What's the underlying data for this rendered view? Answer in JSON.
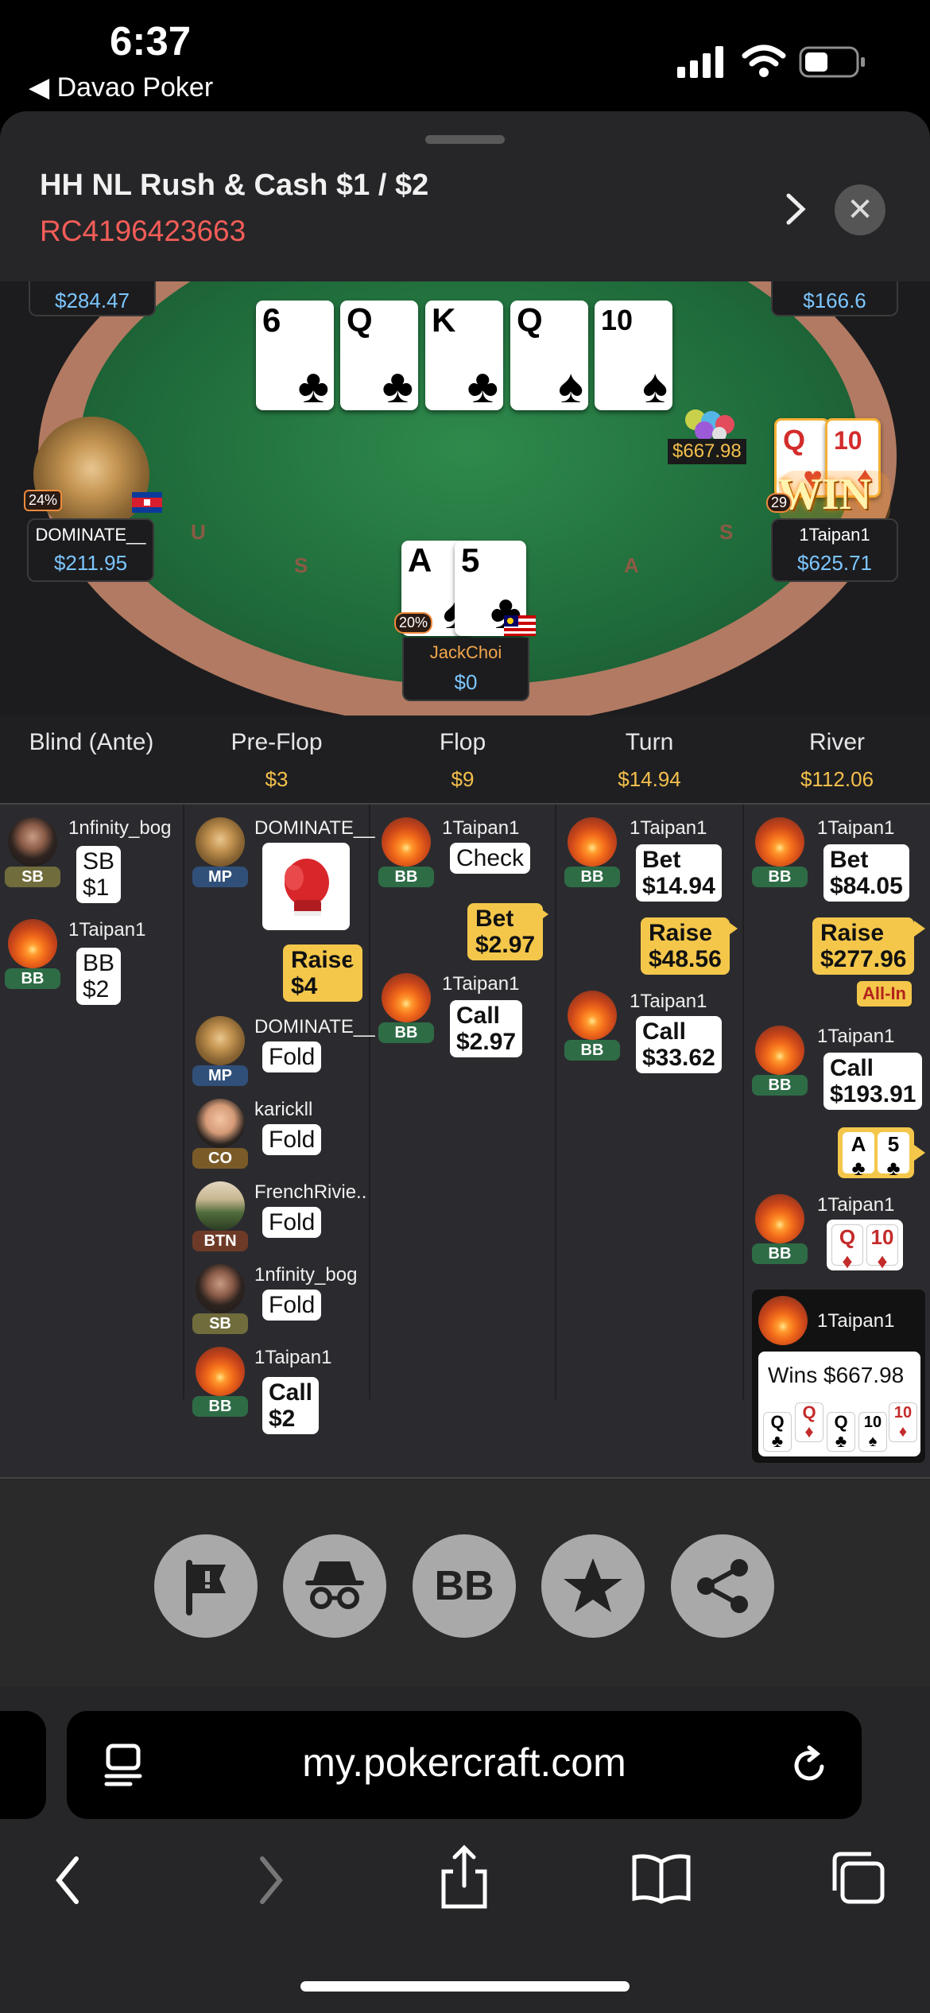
{
  "status_bar": {
    "time": "6:37",
    "back_label": "◀ Davao Poker"
  },
  "header": {
    "title": "HH NL Rush & Cash $1 / $2",
    "hand_id": "RC4196423663"
  },
  "table": {
    "board": [
      {
        "rank": "6",
        "suit": "♣"
      },
      {
        "rank": "Q",
        "suit": "♣"
      },
      {
        "rank": "K",
        "suit": "♣"
      },
      {
        "rank": "Q",
        "suit": "♠"
      },
      {
        "rank": "10",
        "suit": "♠"
      }
    ],
    "rim_letters": [
      "U",
      "S",
      "A",
      "S"
    ],
    "pot": "$667.98",
    "top_left_stack": "$284.47",
    "top_right_stack": "$166.6",
    "left_player": {
      "name": "DOMINATE__",
      "stack": "$211.95",
      "badge": "24%"
    },
    "right_player": {
      "name": "1Taipan1",
      "stack": "$625.71",
      "badge": "29",
      "win_label": "WIN",
      "cards": [
        {
          "rank": "Q",
          "suit": "♥"
        },
        {
          "rank": "10",
          "suit": "♦"
        }
      ]
    },
    "hero": {
      "name": "JackChoi",
      "stack": "$0",
      "badge": "20%",
      "cards": [
        {
          "rank": "A",
          "suit": "♠"
        },
        {
          "rank": "5",
          "suit": "♣"
        }
      ]
    }
  },
  "history": {
    "columns": [
      {
        "title": "Blind (Ante)",
        "pot": ""
      },
      {
        "title": "Pre-Flop",
        "pot": "$3"
      },
      {
        "title": "Flop",
        "pot": "$9"
      },
      {
        "title": "Turn",
        "pot": "$14.94"
      },
      {
        "title": "River",
        "pot": "$112.06"
      }
    ],
    "blind": [
      {
        "name": "1nfinity_bog",
        "pos": "SB",
        "action": "SB",
        "amount": "$1"
      },
      {
        "name": "1Taipan1",
        "pos": "BB",
        "action": "BB",
        "amount": "$2"
      }
    ],
    "preflop": {
      "straddle_name": "DOMINATE__",
      "straddle_pos": "MP",
      "raise_action": "Raise",
      "raise_amount": "$4",
      "rows": [
        {
          "name": "DOMINATE__",
          "pos": "MP",
          "action": "Fold"
        },
        {
          "name": "karickll",
          "pos": "CO",
          "action": "Fold"
        },
        {
          "name": "FrenchRivie..",
          "pos": "BTN",
          "action": "Fold"
        },
        {
          "name": "1nfinity_bog",
          "pos": "SB",
          "action": "Fold"
        }
      ],
      "call": {
        "name": "1Taipan1",
        "pos": "BB",
        "action": "Call",
        "amount": "$2"
      }
    },
    "flop": {
      "p1": {
        "name": "1Taipan1",
        "pos": "BB",
        "action": "Check"
      },
      "hero_bet": {
        "action": "Bet",
        "amount": "$2.97"
      },
      "p2": {
        "name": "1Taipan1",
        "pos": "BB",
        "action": "Call",
        "amount": "$2.97"
      }
    },
    "turn": {
      "p1": {
        "name": "1Taipan1",
        "pos": "BB",
        "action": "Bet",
        "amount": "$14.94"
      },
      "hero_raise": {
        "action": "Raise",
        "amount": "$48.56"
      },
      "p2": {
        "name": "1Taipan1",
        "pos": "BB",
        "action": "Call",
        "amount": "$33.62"
      }
    },
    "river": {
      "p1": {
        "name": "1Taipan1",
        "pos": "BB",
        "action": "Bet",
        "amount": "$84.05"
      },
      "hero_raise": {
        "action": "Raise",
        "amount": "$277.96",
        "tag": "All-In"
      },
      "p2": {
        "name": "1Taipan1",
        "pos": "BB",
        "action": "Call",
        "amount": "$193.91"
      },
      "hero_show": [
        {
          "rank": "A",
          "suit": "♣"
        },
        {
          "rank": "5",
          "suit": "♣"
        }
      ],
      "p3": {
        "name": "1Taipan1",
        "pos": "BB",
        "cards": [
          {
            "rank": "Q",
            "suit": "♦"
          },
          {
            "rank": "10",
            "suit": "♦"
          }
        ]
      },
      "winner": {
        "name": "1Taipan1",
        "text": "Wins $667.98",
        "cards": [
          {
            "rank": "Q",
            "suit": "♣"
          },
          {
            "rank": "Q",
            "suit": "♦"
          },
          {
            "rank": "Q",
            "suit": "♣"
          },
          {
            "rank": "10",
            "suit": "♠"
          },
          {
            "rank": "10",
            "suit": "♦"
          }
        ]
      }
    }
  },
  "toolbar": {
    "bb_label": "BB"
  },
  "browser": {
    "url": "my.pokercraft.com"
  }
}
